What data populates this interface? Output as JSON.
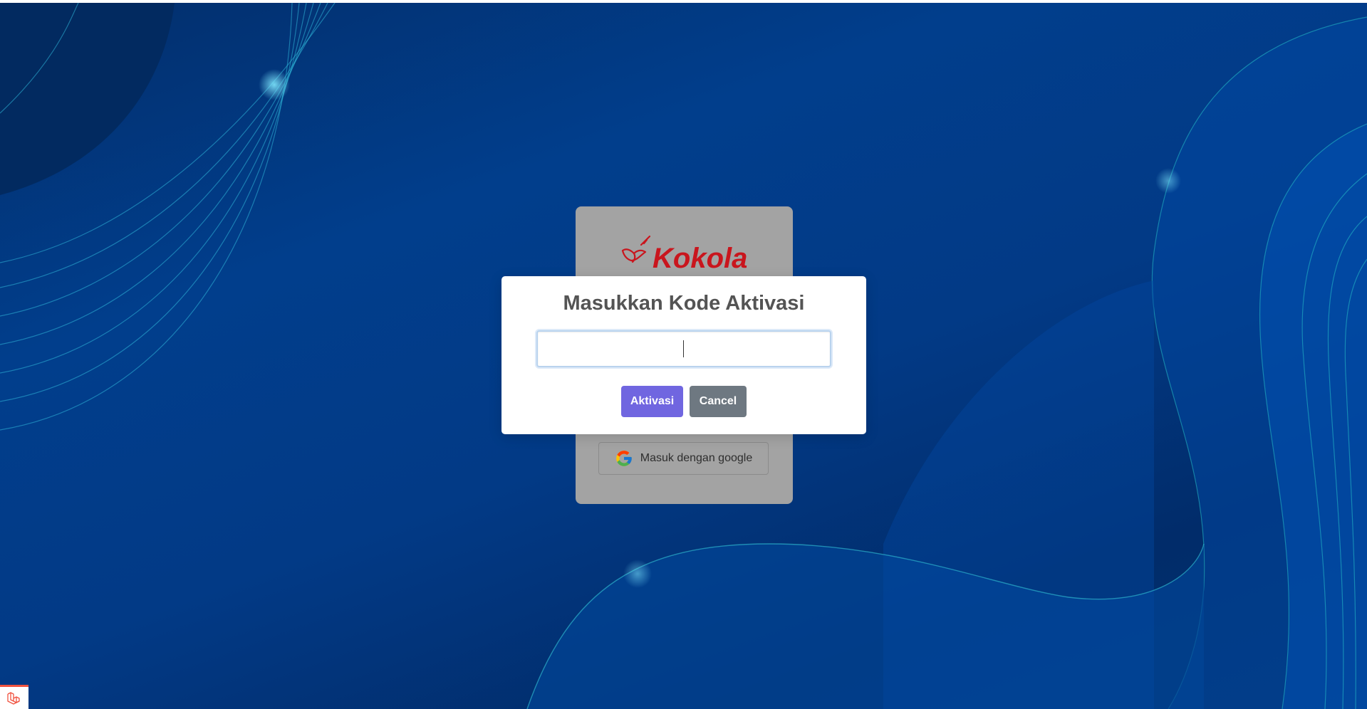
{
  "login_card": {
    "brand_name": "Kokola",
    "google_button_label": "Masuk dengan google",
    "google_icon": "google-icon"
  },
  "modal": {
    "title": "Masukkan Kode Aktivasi",
    "input_value": "",
    "input_placeholder": "",
    "activate_label": "Aktivasi",
    "cancel_label": "Cancel"
  },
  "corner_badge": {
    "icon": "laravel-icon"
  },
  "colors": {
    "background": "#013e8c",
    "brand_red": "#d71920",
    "activate_button": "#7066e0",
    "cancel_button": "#6e7881"
  }
}
